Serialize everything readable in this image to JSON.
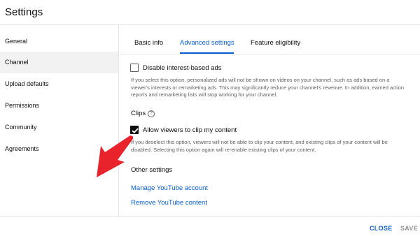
{
  "dialog": {
    "title": "Settings"
  },
  "sidebar": {
    "items": [
      {
        "label": "General",
        "active": false
      },
      {
        "label": "Channel",
        "active": true
      },
      {
        "label": "Upload defaults",
        "active": false
      },
      {
        "label": "Permissions",
        "active": false
      },
      {
        "label": "Community",
        "active": false
      },
      {
        "label": "Agreements",
        "active": false
      }
    ]
  },
  "tabs": [
    {
      "label": "Basic info",
      "active": false
    },
    {
      "label": "Advanced settings",
      "active": true
    },
    {
      "label": "Feature eligibility",
      "active": false
    }
  ],
  "ads": {
    "checkbox_label": "Disable interest-based ads",
    "checked": false,
    "help_text": "If you select this option, personalized ads will not be shown on videos on your channel, such as ads based on a viewer's interests or remarketing ads. This may significantly reduce your channel's revenue. In addition, earned action reports and remarketing lists will stop working for your channel."
  },
  "clips": {
    "heading": "Clips",
    "help_glyph": "?",
    "checkbox_label": "Allow viewers to clip my content",
    "checked": true,
    "help_text": "If you deselect this option, viewers will not be able to clip your content, and existing clips of your content will be disabled. Selecting this option again will re-enable existing clips of your content."
  },
  "other_settings": {
    "heading": "Other settings",
    "links": [
      "Manage YouTube account",
      "Remove YouTube content"
    ]
  },
  "footer": {
    "close_label": "CLOSE",
    "save_label": "SAVE"
  },
  "colors": {
    "accent": "#065fd4",
    "annotation_arrow": "#e8232b",
    "active_sidebar_bg": "#f2f2f2"
  }
}
